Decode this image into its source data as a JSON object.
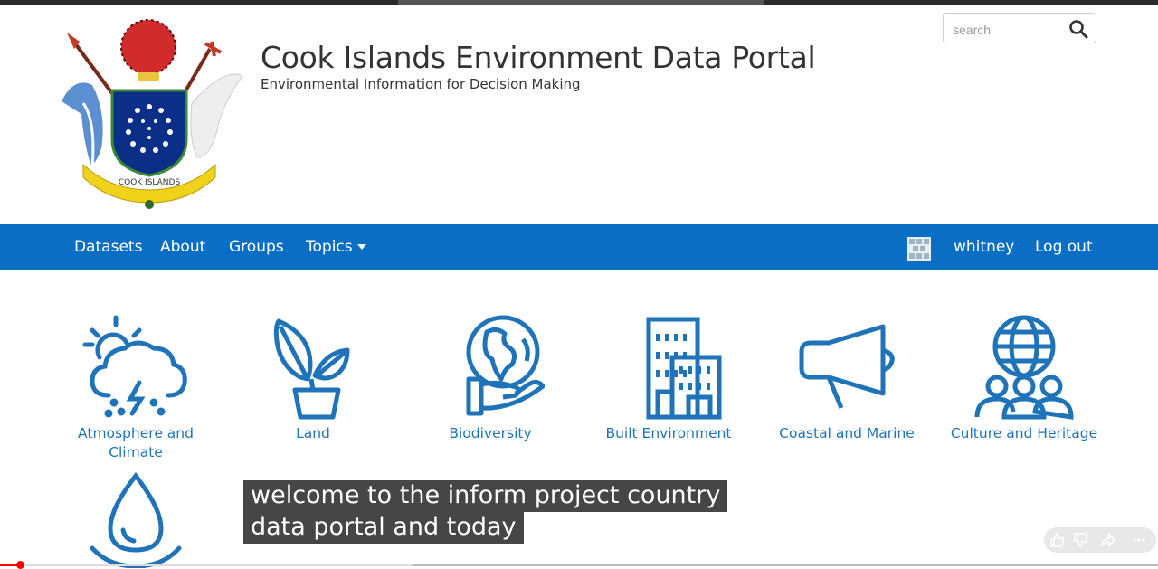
{
  "site": {
    "title": "Cook Islands Environment Data Portal",
    "subtitle": "Environmental Information for Decision Making",
    "logo_text": "COOK ISLANDS"
  },
  "search": {
    "placeholder": "search"
  },
  "nav": {
    "left": [
      "Datasets",
      "About",
      "Groups",
      "Topics"
    ],
    "username": "whitney",
    "logout": "Log out"
  },
  "topics": [
    {
      "label": "Atmosphere and Climate",
      "icon": "weather-icon"
    },
    {
      "label": "Land",
      "icon": "plant-icon"
    },
    {
      "label": "Biodiversity",
      "icon": "globe-hand-icon"
    },
    {
      "label": "Built Environment",
      "icon": "buildings-icon"
    },
    {
      "label": "Coastal and Marine",
      "icon": "megaphone-icon"
    },
    {
      "label": "Culture and Heritage",
      "icon": "globe-people-icon"
    }
  ],
  "caption": {
    "line1": "welcome to the inform project country",
    "line2": "data portal and today"
  },
  "video": {
    "played_fraction": 0.017,
    "loaded_fraction": 0.356
  },
  "colors": {
    "nav_bg": "#0a6fc4",
    "icon_blue": "#1f73b8"
  }
}
